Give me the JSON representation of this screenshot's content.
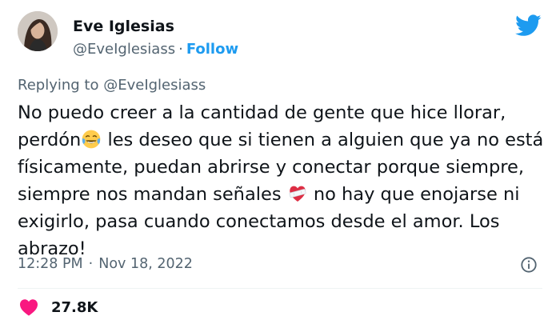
{
  "author": {
    "name": "Eve Iglesias",
    "handle": "@EveIglesiass",
    "separator": "·",
    "follow_label": "Follow"
  },
  "reply": {
    "prefix": "Replying to",
    "mention": "@EveIglesiass"
  },
  "tweet": {
    "text_1": "No puedo creer a la cantidad de gente que hice llorar, perdón",
    "emoji_1": "face-with-tears-of-joy",
    "text_2": " les deseo que si tienen a alguien que ya no está físicamente, puedan abrirse y conectar porque siempre, siempre nos mandan señales ",
    "emoji_2": "mending-heart",
    "text_3": " no hay que enojarse ni exigirlo, pasa cuando conectamos desde el amor. Los abrazo!"
  },
  "meta": {
    "time": "12:28 PM",
    "separator": "·",
    "date": "Nov 18, 2022"
  },
  "stats": {
    "likes": "27.8K"
  },
  "colors": {
    "accent": "#1d9bf0",
    "secondary_text": "#536471",
    "like": "#f91880"
  }
}
